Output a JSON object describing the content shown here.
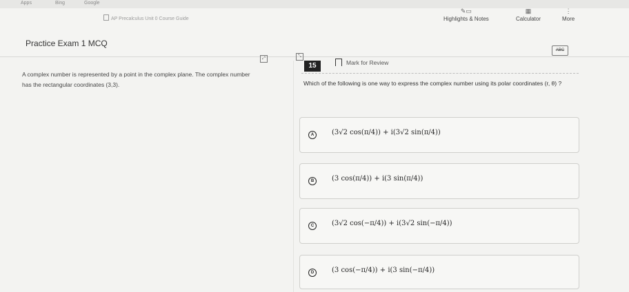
{
  "browser": {
    "items": [
      "Apps",
      "Bing",
      "Google"
    ]
  },
  "guide": {
    "label": "AP Precalculus Unit 0 Course Guide"
  },
  "header": {
    "exam_title": "Practice Exam 1 MCQ",
    "tools": [
      {
        "label": "Highlights & Notes",
        "icon": "pen-note-icon"
      },
      {
        "label": "Calculator",
        "icon": "calculator-icon"
      },
      {
        "label": "More",
        "icon": "more-vertical-icon"
      }
    ]
  },
  "stimulus": {
    "text": "A complex number is represented by a point in the complex plane. The complex number has the rectangular coordinates (3,3)."
  },
  "question": {
    "number": "15",
    "mark_for_review": "Mark for Review",
    "prompt": "Which of the following is one way to express the complex number using its polar coordinates (r, θ) ?"
  },
  "choices": [
    {
      "letter": "A",
      "text": "(3√2 cos(π/4)) + i(3√2 sin(π/4))"
    },
    {
      "letter": "B",
      "text": "(3 cos(π/4)) + i(3 sin(π/4))"
    },
    {
      "letter": "C",
      "text": "(3√2 cos(−π/4)) + i(3√2 sin(−π/4))"
    },
    {
      "letter": "D",
      "text": "(3 cos(−π/4)) + i(3 sin(−π/4))"
    }
  ],
  "colors": {
    "background": "#f3f3f1",
    "accent": "#222222",
    "border": "#cfcfcc"
  }
}
